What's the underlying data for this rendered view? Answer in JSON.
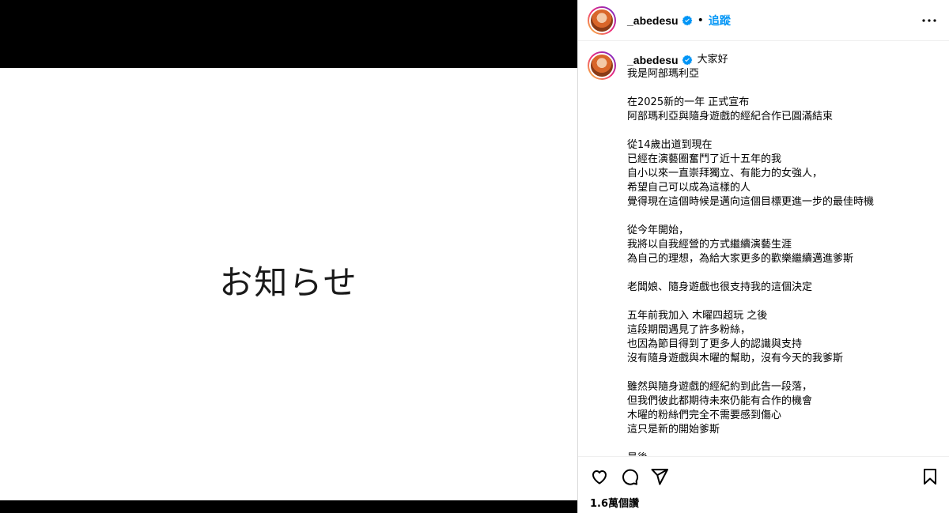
{
  "media": {
    "notice_text": "お知らせ"
  },
  "header": {
    "username": "_abedesu",
    "separator": "•",
    "follow_label": "追蹤"
  },
  "caption": {
    "username": "_abedesu",
    "first_line": "大家好",
    "body": "我是阿部瑪利亞\n\n在2025新的一年 正式宣布\n阿部瑪利亞與隨身遊戲的經紀合作已圓滿結束\n\n從14歲出道到現在\n已經在演藝圈奮鬥了近十五年的我\n自小以來一直崇拜獨立、有能力的女強人，\n希望自己可以成為這樣的人\n覺得現在這個時候是邁向這個目標更進一步的最佳時機\n\n從今年開始，\n我將以自我經營的方式繼續演藝生涯\n為自己的理想，為給大家更多的歡樂繼續邁進爹斯\n\n老闆娘、隨身遊戲也很支持我的這個決定\n\n五年前我加入 木曜四超玩 之後\n這段期間遇見了許多粉絲，\n也因為節目得到了更多人的認識與支持\n沒有隨身遊戲與木曜的幫助，沒有今天的我爹斯\n\n雖然與隨身遊戲的經紀約到此告一段落，\n但我們彼此都期待未來仍能有合作的機會\n木曜的粉絲們完全不需要感到傷心\n這只是新的開始爹斯\n\n最後，"
  },
  "footer": {
    "views": "1.6萬個讚"
  },
  "colors": {
    "accent": "#0095f6",
    "verified": "#0095f6"
  },
  "icons": [
    "verified-icon",
    "more-options-icon",
    "heart-icon",
    "comment-icon",
    "share-icon",
    "bookmark-icon"
  ]
}
